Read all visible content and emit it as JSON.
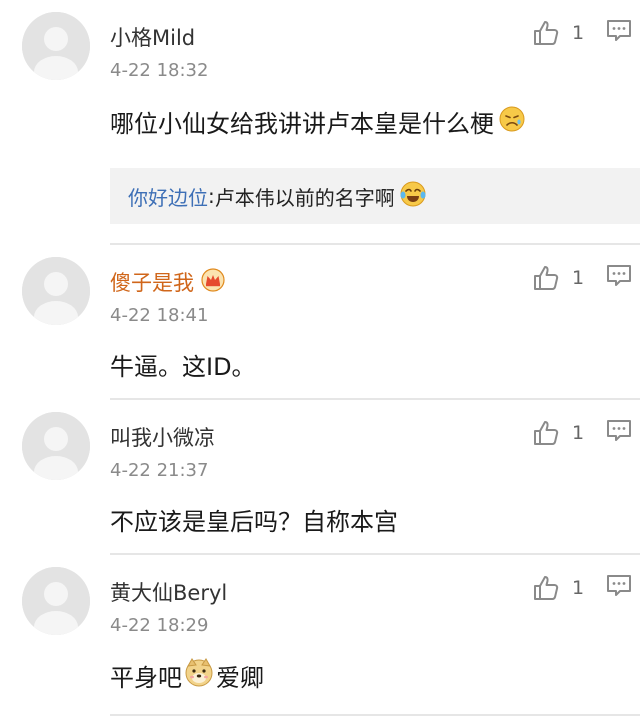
{
  "comments": [
    {
      "user": "小格Mild",
      "time": "4-22 18:32",
      "text": "哪位小仙女给我讲讲卢本皇是什么梗",
      "text_emoji": "sad-face-emoji",
      "likes": "1",
      "reply": {
        "user": "你好边位",
        "separator": ": ",
        "text": "卢本伟以前的名字啊",
        "emoji": "laughing-tears-emoji"
      }
    },
    {
      "user": "傻子是我",
      "user_badge": "crown-badge-icon",
      "time": "4-22 18:41",
      "text": "牛逼。这ID。",
      "likes": "1"
    },
    {
      "user": "叫我小微凉",
      "time": "4-22 21:37",
      "text": "不应该是皇后吗？自称本宫",
      "likes": "1"
    },
    {
      "user": "黄大仙Beryl",
      "time": "4-22 18:29",
      "text_before_emoji": "平身吧",
      "text_emoji": "doge-emoji",
      "text_after_emoji": "爱卿",
      "likes": "1"
    }
  ],
  "icons": {
    "like": "thumbs-up-icon",
    "reply": "comment-bubble-icon",
    "avatar": "default-avatar-icon"
  },
  "colors": {
    "vip_name": "#d0661a",
    "reply_name": "#3d6fb6",
    "timestamp": "#8a8a8a",
    "reply_bg": "#f2f2f2"
  }
}
